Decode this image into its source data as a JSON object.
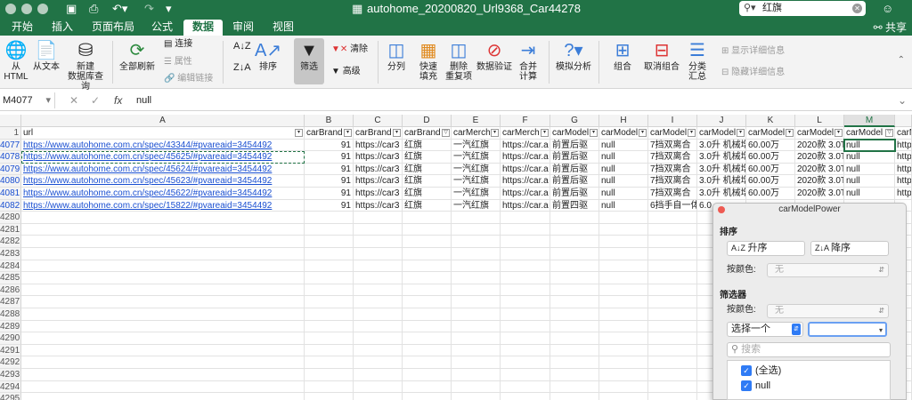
{
  "window": {
    "title": "autohome_20200820_Url9368_Car44278"
  },
  "search": {
    "value": "红旗"
  },
  "tabs": [
    "开始",
    "插入",
    "页面布局",
    "公式",
    "数据",
    "审阅",
    "视图"
  ],
  "share_label": "共享",
  "ribbon": {
    "from_html": "从\nHTML",
    "from_text": "从文本",
    "new_db_query": "新建\n数据库查询",
    "refresh_all": "全部刷新",
    "connections": "连接",
    "properties": "属性",
    "edit_links": "编辑链接",
    "sort": "排序",
    "filter": "筛选",
    "clear": "清除",
    "advanced": "高级",
    "text_to_columns": "分列",
    "flash_fill": "快速\n填充",
    "remove_duplicates": "删除\n重复项",
    "data_validation": "数据验证",
    "consolidate": "合并\n计算",
    "what_if": "模拟分析",
    "group": "组合",
    "ungroup": "取消组合",
    "subtotal": "分类\n汇总",
    "show_detail": "显示详细信息",
    "hide_detail": "隐藏详细信息"
  },
  "formula": {
    "cell_ref": "M4077",
    "value": "null"
  },
  "columns": [
    "A",
    "B",
    "C",
    "D",
    "E",
    "F",
    "G",
    "H",
    "I",
    "J",
    "K",
    "L",
    "M"
  ],
  "header_row": {
    "row_num": "1",
    "cells": [
      "url",
      "carBrand",
      "carBrand",
      "carBrand",
      "carMerch",
      "carMerch",
      "carModel",
      "carModel",
      "carModel",
      "carModel",
      "carModel",
      "carModel",
      "carModel",
      "carM"
    ]
  },
  "rows": [
    {
      "num": "4077",
      "cells": [
        "https://www.autohome.com.cn/spec/43344/#pvareaid=3454492",
        "91",
        "https://car3",
        "红旗",
        "一汽红旗",
        "https://car.a",
        "前置后驱",
        "null",
        "7挡双离合",
        "3.0升 机械增",
        "60.00万",
        "2020款 3.0T",
        "null",
        "http"
      ]
    },
    {
      "num": "4078",
      "cells": [
        "https://www.autohome.com.cn/spec/45625/#pvareaid=3454492",
        "91",
        "https://car3",
        "红旗",
        "一汽红旗",
        "https://car.a",
        "前置后驱",
        "null",
        "7挡双离合",
        "3.0升 机械增",
        "60.00万",
        "2020款 3.0T",
        "null",
        "http"
      ]
    },
    {
      "num": "4079",
      "cells": [
        "https://www.autohome.com.cn/spec/45624/#pvareaid=3454492",
        "91",
        "https://car3",
        "红旗",
        "一汽红旗",
        "https://car.a",
        "前置后驱",
        "null",
        "7挡双离合",
        "3.0升 机械增",
        "60.00万",
        "2020款 3.0T",
        "null",
        "http"
      ]
    },
    {
      "num": "4080",
      "cells": [
        "https://www.autohome.com.cn/spec/45623/#pvareaid=3454492",
        "91",
        "https://car3",
        "红旗",
        "一汽红旗",
        "https://car.a",
        "前置后驱",
        "null",
        "7挡双离合",
        "3.0升 机械增",
        "60.00万",
        "2020款 3.0T",
        "null",
        "http"
      ]
    },
    {
      "num": "4081",
      "cells": [
        "https://www.autohome.com.cn/spec/45622/#pvareaid=3454492",
        "91",
        "https://car3",
        "红旗",
        "一汽红旗",
        "https://car.a",
        "前置后驱",
        "null",
        "7挡双离合",
        "3.0升 机械增",
        "60.00万",
        "2020款 3.0T",
        "null",
        "http"
      ]
    },
    {
      "num": "4082",
      "cells": [
        "https://www.autohome.com.cn/spec/15822/#pvareaid=3454492",
        "91",
        "https://car3",
        "红旗",
        "一汽红旗",
        "https://car.a",
        "前置四驱",
        "null",
        "6挡手自一体",
        "6.0",
        "",
        "",
        "",
        ""
      ]
    }
  ],
  "empty_rows": [
    "4280",
    "4281",
    "4282",
    "4283",
    "4284",
    "4285",
    "4286",
    "4287",
    "4288",
    "4289",
    "4290",
    "4291",
    "4292",
    "4293",
    "4294",
    "4295"
  ],
  "filter_popup": {
    "title": "carModelPower",
    "sort_section": "排序",
    "sort_asc": "升序",
    "sort_desc": "降序",
    "by_color": "按颜色:",
    "color_none": "无",
    "filter_section": "筛选器",
    "filter_by_color": "按颜色:",
    "filter_color_none": "无",
    "choose_one": "选择一个",
    "search_placeholder": "搜索",
    "items": [
      "(全选)",
      "null"
    ]
  },
  "colors": {
    "excel_green": "#217346",
    "link_blue": "#1a4fd1"
  }
}
